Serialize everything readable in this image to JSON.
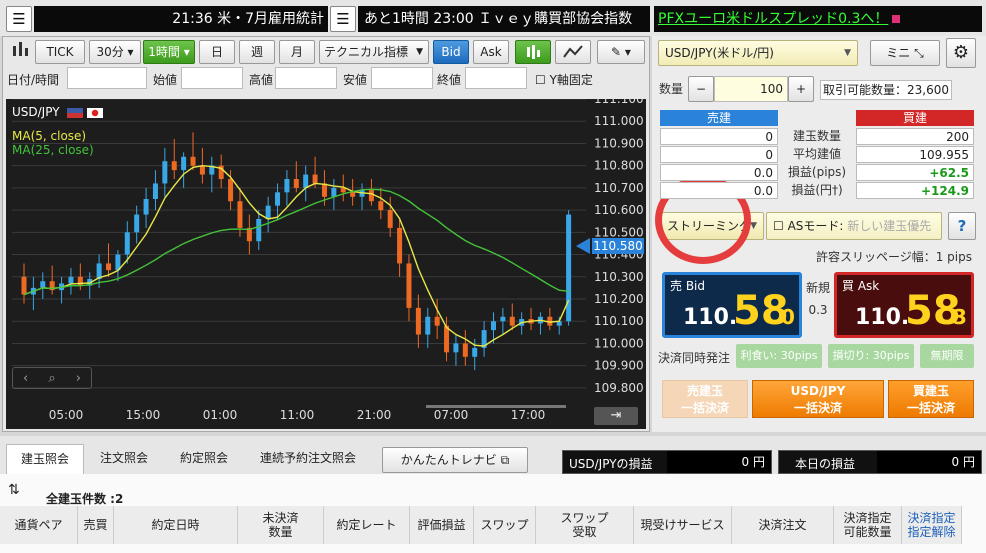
{
  "ticker": {
    "news1": "21:36 米・7月雇用統計",
    "news2": "あと1時間 23:00 Ｉｖｅｙ購買部協会指数",
    "ad": "PFXユーロ米ドルスプレッド0.3へ！"
  },
  "toolbar": {
    "tick": "TICK",
    "minute": "30分 ▾",
    "hour": "1時間 ▾",
    "day": "日",
    "week": "週",
    "month": "月",
    "indicators": "テクニカル指標",
    "bid": "Bid",
    "ask": "Ask"
  },
  "ohlc": {
    "datetime": "日付/時間",
    "open": "始値",
    "high": "高値",
    "low": "安値",
    "close": "終値",
    "yfix": "Y軸固定"
  },
  "chart_data": {
    "type": "candlestick",
    "pair_label": "USD/JPY",
    "ma5_label": "MA(5, close)",
    "ma25_label": "MA(25, close)",
    "colors": {
      "up": "#3aa7e6",
      "down": "#ee6a23",
      "ma5": "#e8e848",
      "ma25": "#44c23a",
      "bg": "#1d1d1d"
    },
    "ylim": [
      109.75,
      111.1
    ],
    "y_ticks": [
      "111.100",
      "111.000",
      "110.900",
      "110.800",
      "110.700",
      "110.600",
      "110.500",
      "110.400",
      "110.300",
      "110.200",
      "110.100",
      "110.000",
      "109.900",
      "109.800"
    ],
    "x_ticks": [
      "05:00",
      "15:00",
      "01:00",
      "11:00",
      "21:00",
      "07:00",
      "17:00"
    ],
    "current_price": "110.580",
    "candles": [
      [
        110.3,
        110.36,
        110.18,
        110.22
      ],
      [
        110.22,
        110.3,
        110.15,
        110.25
      ],
      [
        110.25,
        110.32,
        110.2,
        110.28
      ],
      [
        110.28,
        110.35,
        110.22,
        110.24
      ],
      [
        110.24,
        110.3,
        110.18,
        110.27
      ],
      [
        110.27,
        110.34,
        110.22,
        110.3
      ],
      [
        110.3,
        110.36,
        110.24,
        110.26
      ],
      [
        110.26,
        110.32,
        110.2,
        110.29
      ],
      [
        110.29,
        110.4,
        110.25,
        110.36
      ],
      [
        110.36,
        110.45,
        110.3,
        110.33
      ],
      [
        110.33,
        110.42,
        110.28,
        110.4
      ],
      [
        110.4,
        110.55,
        110.36,
        110.5
      ],
      [
        110.5,
        110.62,
        110.45,
        110.58
      ],
      [
        110.58,
        110.7,
        110.52,
        110.65
      ],
      [
        110.65,
        110.78,
        110.6,
        110.72
      ],
      [
        110.72,
        110.88,
        110.66,
        110.82
      ],
      [
        110.82,
        110.92,
        110.74,
        110.78
      ],
      [
        110.78,
        110.86,
        110.7,
        110.84
      ],
      [
        110.84,
        110.95,
        110.78,
        110.8
      ],
      [
        110.8,
        110.88,
        110.72,
        110.76
      ],
      [
        110.76,
        110.84,
        110.68,
        110.8
      ],
      [
        110.8,
        110.85,
        110.7,
        110.74
      ],
      [
        110.74,
        110.78,
        110.6,
        110.64
      ],
      [
        110.64,
        110.7,
        110.48,
        110.52
      ],
      [
        110.52,
        110.58,
        110.4,
        110.46
      ],
      [
        110.46,
        110.6,
        110.42,
        110.56
      ],
      [
        110.56,
        110.66,
        110.5,
        110.62
      ],
      [
        110.62,
        110.72,
        110.56,
        110.68
      ],
      [
        110.68,
        110.78,
        110.62,
        110.74
      ],
      [
        110.74,
        110.82,
        110.68,
        110.7
      ],
      [
        110.7,
        110.8,
        110.64,
        110.76
      ],
      [
        110.76,
        110.84,
        110.7,
        110.72
      ],
      [
        110.72,
        110.78,
        110.62,
        110.66
      ],
      [
        110.66,
        110.74,
        110.6,
        110.7
      ],
      [
        110.7,
        110.76,
        110.64,
        110.68
      ],
      [
        110.68,
        110.74,
        110.62,
        110.66
      ],
      [
        110.66,
        110.72,
        110.6,
        110.69
      ],
      [
        110.69,
        110.74,
        110.62,
        110.64
      ],
      [
        110.64,
        110.7,
        110.56,
        110.6
      ],
      [
        110.6,
        110.66,
        110.48,
        110.52
      ],
      [
        110.52,
        110.56,
        110.3,
        110.36
      ],
      [
        110.36,
        110.4,
        110.1,
        110.16
      ],
      [
        110.16,
        110.22,
        109.98,
        110.04
      ],
      [
        110.04,
        110.16,
        109.98,
        110.12
      ],
      [
        110.12,
        110.2,
        110.02,
        110.08
      ],
      [
        110.08,
        110.12,
        109.92,
        109.96
      ],
      [
        109.96,
        110.04,
        109.9,
        110.0
      ],
      [
        110.0,
        110.06,
        109.9,
        109.94
      ],
      [
        109.94,
        110.02,
        109.88,
        109.98
      ],
      [
        109.98,
        110.1,
        109.94,
        110.06
      ],
      [
        110.06,
        110.14,
        110.0,
        110.1
      ],
      [
        110.1,
        110.16,
        110.04,
        110.12
      ],
      [
        110.12,
        110.18,
        110.06,
        110.08
      ],
      [
        110.08,
        110.14,
        110.04,
        110.11
      ],
      [
        110.11,
        110.16,
        110.06,
        110.09
      ],
      [
        110.09,
        110.14,
        110.04,
        110.12
      ],
      [
        110.12,
        110.16,
        110.06,
        110.08
      ],
      [
        110.08,
        110.12,
        110.04,
        110.1
      ],
      [
        110.1,
        110.6,
        110.08,
        110.58
      ]
    ]
  },
  "panel": {
    "pair_select": "USD/JPY(米ドル/円)",
    "mini": "ミニ",
    "qty_label": "数量",
    "qty_minus": "−",
    "qty_value": "100",
    "qty_plus": "+",
    "available": "取引可能数量：23,600",
    "sell_header": "売建",
    "buy_header": "買建",
    "rows": [
      {
        "sell": "0",
        "label": "建玉数量",
        "buy": "200",
        "buy_color": "#222"
      },
      {
        "sell": "0",
        "label": "平均建値",
        "buy": "109.955",
        "buy_color": "#222"
      },
      {
        "sell": "0.0",
        "label": "損益(pips)",
        "buy": "+62.5",
        "buy_color": "#1a9a1a"
      },
      {
        "sell": "0.0",
        "label": "損益(円†)",
        "buy": "+124.9",
        "buy_color": "#1a9a1a"
      }
    ],
    "streaming": "ストリーミング",
    "as_mode": "ASモード:",
    "as_placeholder": "新しい建玉優先",
    "help": "?",
    "slippage": "許容スリッページ幅：1 pips",
    "sell_bid_label": "売 Bid",
    "sell_bid_big": "110.",
    "sell_bid_pips": "58",
    "sell_bid_frac": "0",
    "new_label": "新規",
    "spread": "0.3",
    "buy_ask_label": "買 Ask",
    "buy_ask_big": "110.",
    "buy_ask_pips": "58",
    "buy_ask_frac": "3",
    "settle_label": "決済同時発注",
    "profit": "利食い: 30pips",
    "loss": "損切り: 30pips",
    "unlimited": "無期限",
    "close_sell": "売建玉\n一括決済",
    "close_all": "USD/JPY\n一括決済",
    "close_buy": "買建玉\n一括決済"
  },
  "bottom": {
    "tabs": [
      "建玉照会",
      "注文照会",
      "約定照会",
      "連続予約注文照会"
    ],
    "navi": "かんたんトレナビ",
    "pl_pair_label": "USD/JPYの損益",
    "pl_pair_value": "0 円",
    "pl_today_label": "本日の損益",
    "pl_today_value": "0 円",
    "count": "全建玉件数 :2",
    "columns": [
      "通貨ペア",
      "売買",
      "約定日時",
      "未決済\n数量",
      "約定レート",
      "評価損益",
      "スワップ",
      "スワップ\n受取",
      "現受けサービス",
      "決済注文",
      "決済指定\n可能数量",
      "決済指定\n指定解除"
    ]
  }
}
